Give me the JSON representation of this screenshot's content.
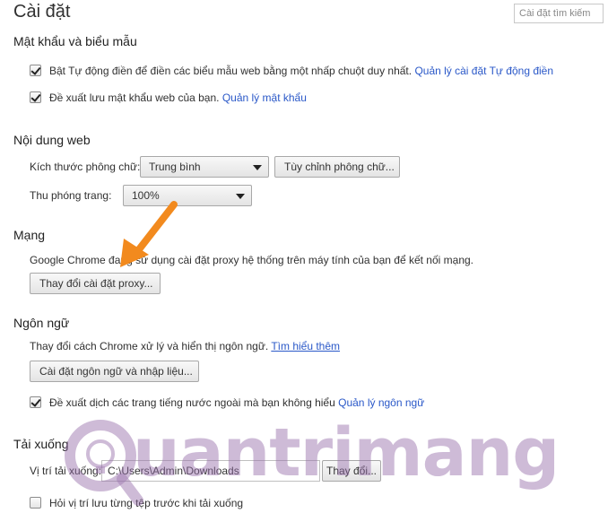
{
  "header": {
    "title": "Cài đặt",
    "search_placeholder": "Cài đặt tìm kiếm"
  },
  "passwords": {
    "title": "Mật khẩu và biểu mẫu",
    "autofill": {
      "checked": true,
      "label": "Bật Tự động điền để điền các biểu mẫu web bằng một nhấp chuột duy nhất.",
      "link": "Quản lý cài đặt Tự động điền"
    },
    "save_passwords": {
      "checked": true,
      "label": "Đề xuất lưu mật khẩu web của bạn.",
      "link": "Quản lý mật khẩu"
    }
  },
  "web_content": {
    "title": "Nội dung web",
    "font_size_label": "Kích thước phông chữ:",
    "font_size_value": "Trung bình",
    "customize_fonts_button": "Tùy chỉnh phông chữ...",
    "page_zoom_label": "Thu phóng trang:",
    "page_zoom_value": "100%"
  },
  "network": {
    "title": "Mạng",
    "description": "Google Chrome đang sử dụng cài đặt proxy hệ thống trên máy tính của bạn để kết nối mạng.",
    "proxy_button": "Thay đổi cài đặt proxy..."
  },
  "languages": {
    "title": "Ngôn ngữ",
    "description": "Thay đổi cách Chrome xử lý và hiển thị ngôn ngữ.",
    "learn_more_link": "Tìm hiểu thêm",
    "settings_button": "Cài đặt ngôn ngữ và nhập liệu...",
    "translate": {
      "checked": true,
      "label": "Đề xuất dịch các trang tiếng nước ngoài mà bạn không hiểu",
      "link": "Quản lý ngôn ngữ"
    }
  },
  "downloads": {
    "title": "Tải xuống",
    "location_label": "Vị trí tải xuống:",
    "location_value": "C:\\Users\\Admin\\Downloads",
    "change_button": "Thay đổi...",
    "ask_location": {
      "checked": false,
      "label": "Hỏi vị trí lưu từng tệp trước khi tải xuống"
    }
  },
  "watermark": {
    "text": "uantrimang"
  },
  "colors": {
    "link": "#2a58c8",
    "annotation_arrow": "#f28a1e"
  }
}
